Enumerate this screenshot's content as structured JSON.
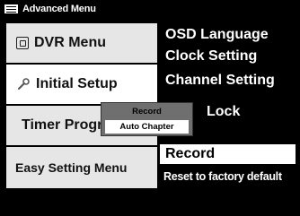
{
  "window": {
    "title": "Advanced Menu",
    "icon": "menu-icon"
  },
  "left_menu": {
    "items": [
      {
        "label": "DVR Menu",
        "icon": "dvr-icon"
      },
      {
        "label": "Initial Setup",
        "icon": "wrench-icon"
      },
      {
        "label": "Timer Programming",
        "icon": "list-icon"
      },
      {
        "label": "Easy Setting Menu",
        "icon": ""
      }
    ],
    "selected_index": 1
  },
  "right_menu": {
    "items": [
      {
        "label": "OSD Language"
      },
      {
        "label": "Clock Setting"
      },
      {
        "label": "Channel Setting"
      },
      {
        "label": "Lock"
      },
      {
        "label": "Record"
      },
      {
        "label": "Reset to factory default"
      }
    ],
    "highlighted_index": 4
  },
  "popup": {
    "items": [
      {
        "label": "Record"
      },
      {
        "label": "Auto Chapter"
      }
    ],
    "active_index": 1
  },
  "colors": {
    "background": "#000000",
    "panel_item": "#e6e6e6",
    "selected_item": "#ffffff",
    "popup": "#6f6f6f",
    "highlight": "#ffffff"
  }
}
